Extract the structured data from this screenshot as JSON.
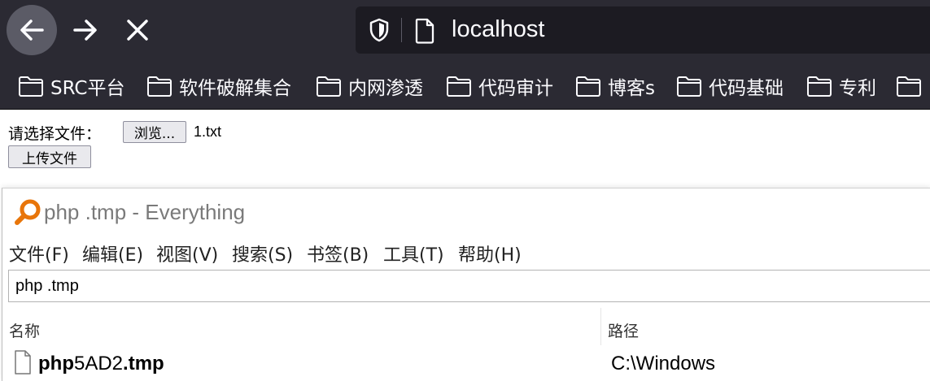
{
  "browser": {
    "url": "localhost",
    "bookmarks": [
      "SRC平台",
      "软件破解集合",
      "内网渗透",
      "代码审计",
      "博客s",
      "代码基础",
      "专利"
    ]
  },
  "upload_form": {
    "label": "请选择文件：",
    "browse_button": "浏览...",
    "selected_file": "1.txt",
    "upload_button": "上传文件"
  },
  "everything": {
    "window_title": "php .tmp - Everything",
    "menu": [
      "文件(F)",
      "编辑(E)",
      "视图(V)",
      "搜索(S)",
      "书签(B)",
      "工具(T)",
      "帮助(H)"
    ],
    "search_value": "php .tmp",
    "columns": {
      "name": "名称",
      "path": "路径"
    },
    "results": [
      {
        "name_prefix": "php",
        "name_middle": "5AD2",
        "name_ext": ".tmp",
        "path": "C:\\Windows"
      }
    ]
  }
}
